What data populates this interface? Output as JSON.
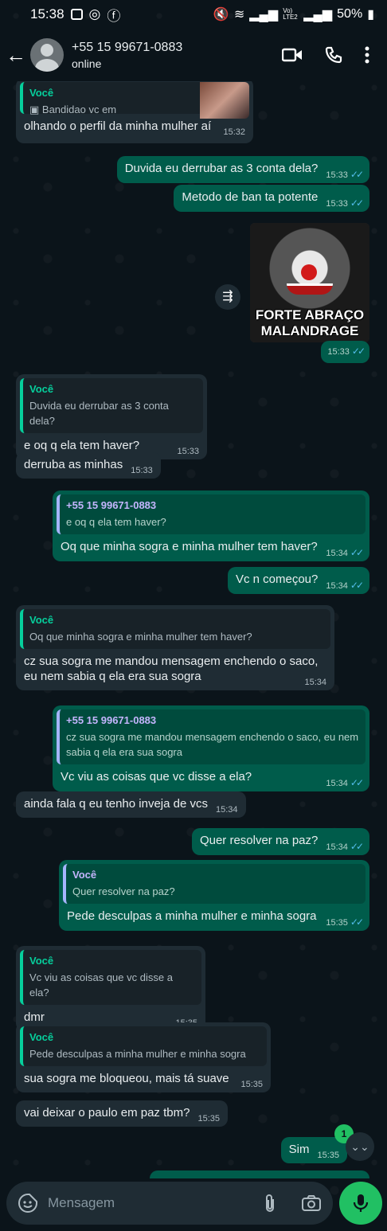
{
  "status": {
    "time": "15:38",
    "battery": "50%",
    "network": "Vo) LTE2"
  },
  "header": {
    "name": "+55 15 99671-0883",
    "status": "online"
  },
  "messages": {
    "m1": {
      "quote_name": "Você",
      "quote_text": "Bandidao vc em",
      "text": "olhando o perfil da minha mulher aí",
      "time": "15:32"
    },
    "m2": {
      "text": "Duvida eu derrubar as 3 conta dela?",
      "time": "15:33"
    },
    "m3": {
      "text": "Metodo de ban ta potente",
      "time": "15:33"
    },
    "m4": {
      "sticker_text": "FORTE ABRAÇO MALANDRAGE",
      "time": "15:33"
    },
    "m5": {
      "quote_name": "Você",
      "quote_text": "Duvida eu derrubar as 3 conta dela?",
      "text": "e oq q ela tem haver?",
      "time": "15:33"
    },
    "m6": {
      "text": "derruba as minhas",
      "time": "15:33"
    },
    "m7": {
      "quote_name": "+55 15 99671-0883",
      "quote_text": "e oq q ela tem haver?",
      "text": "Oq que minha sogra e minha mulher tem haver?",
      "time": "15:34"
    },
    "m8": {
      "text": "Vc n começou?",
      "time": "15:34"
    },
    "m9": {
      "quote_name": "Você",
      "quote_text": "Oq que minha sogra e minha mulher tem haver?",
      "text": "cz sua sogra me mandou mensagem enchendo o saco, eu nem sabia q ela era sua sogra",
      "time": "15:34"
    },
    "m10": {
      "quote_name": "+55 15 99671-0883",
      "quote_text": "cz sua sogra me mandou mensagem enchendo o saco, eu nem sabia q ela era sua sogra",
      "text": "Vc viu as coisas que vc disse a ela?",
      "time": "15:34"
    },
    "m11": {
      "text": "ainda fala q eu tenho inveja de vcs",
      "time": "15:34"
    },
    "m12": {
      "text": "Quer resolver na paz?",
      "time": "15:34"
    },
    "m13": {
      "quote_name": "Você",
      "quote_text": "Quer resolver na paz?",
      "text": "Pede desculpas a minha mulher e minha sogra",
      "time": "15:35"
    },
    "m14": {
      "quote_name": "Você",
      "quote_text": "Vc viu as coisas que vc disse a ela?",
      "text": "dmr",
      "time": "15:35"
    },
    "m15": {
      "quote_name": "Você",
      "quote_text": "Pede desculpas a minha mulher e minha sogra",
      "text": "sua sogra me bloqueou, mais tá suave",
      "time": "15:35"
    },
    "m16": {
      "text": "vai deixar o paulo em paz tbm?",
      "time": "15:35"
    },
    "m17": {
      "text": "Sim",
      "time": "15:35"
    }
  },
  "composer": {
    "placeholder": "Mensagem"
  },
  "unread_badge": "1",
  "colors": {
    "background": "#0b141a",
    "incoming": "#1f2c34",
    "outgoing": "#005c4b",
    "accent": "#21c063",
    "read_ticks": "#53bdeb"
  }
}
